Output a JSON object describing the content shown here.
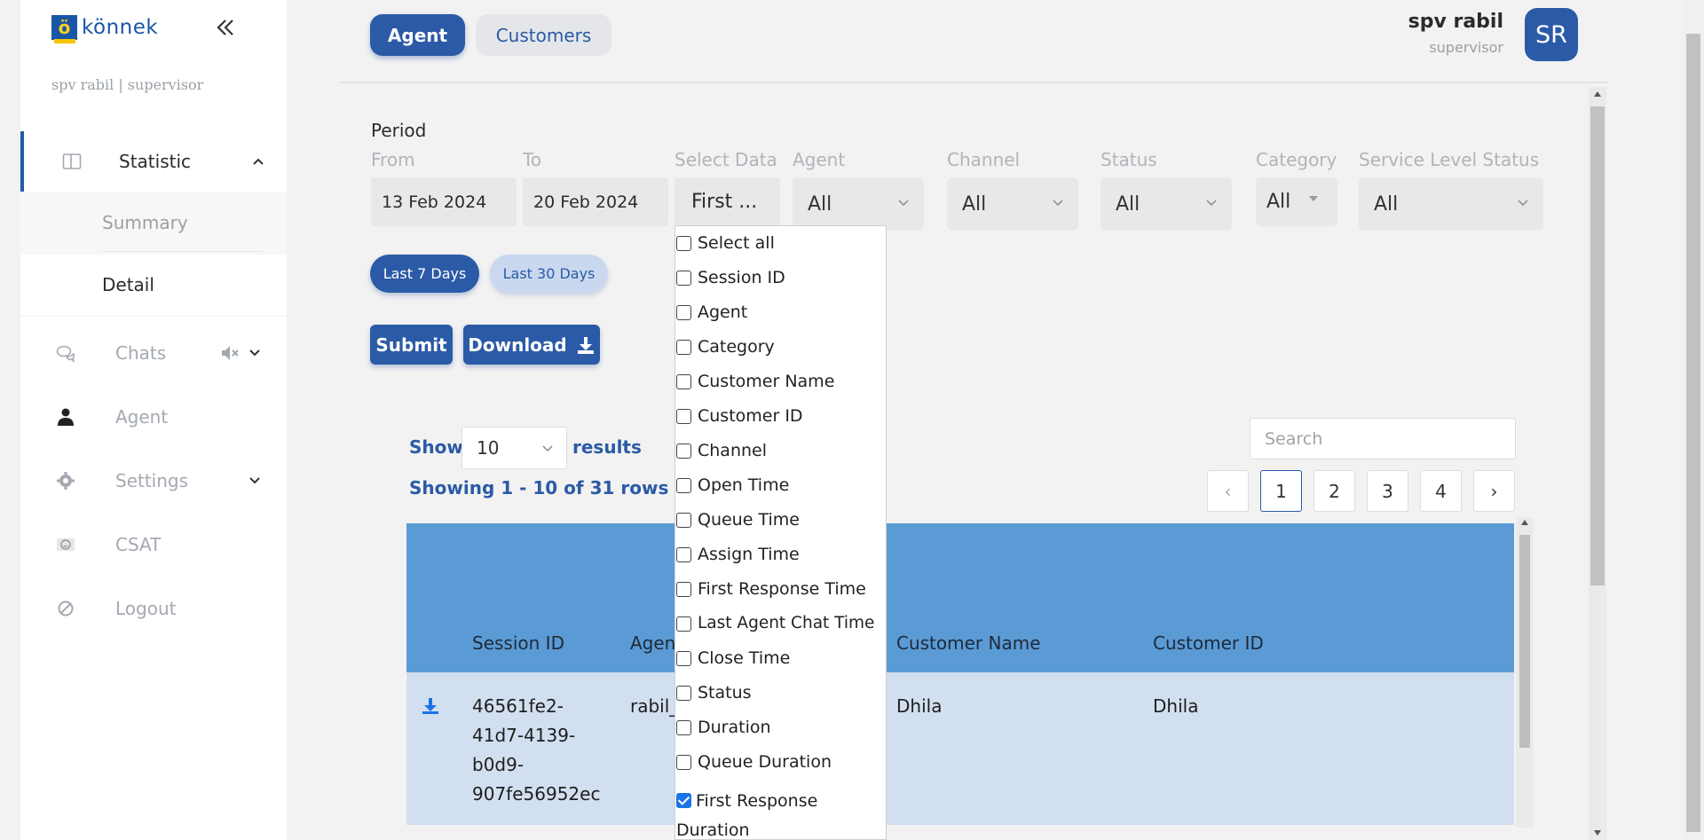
{
  "brand": {
    "name": "könnek",
    "mark": "ö"
  },
  "sidebar": {
    "user_line": "spv rabil | supervisor",
    "items": [
      {
        "label": "Statistic"
      },
      {
        "label": "Chats"
      },
      {
        "label": "Agent"
      },
      {
        "label": "Settings"
      },
      {
        "label": "CSAT"
      },
      {
        "label": "Logout"
      }
    ],
    "sub_items": [
      {
        "label": "Summary"
      },
      {
        "label": "Detail"
      }
    ]
  },
  "tabs": {
    "agent": "Agent",
    "customers": "Customers"
  },
  "profile": {
    "name": "spv rabil",
    "role": "supervisor",
    "initials": "SR"
  },
  "filters": {
    "period_label": "Period",
    "from_label": "From",
    "from_value": "13 Feb 2024",
    "to_label": "To",
    "to_value": "20 Feb 2024",
    "select_data_label": "Select Data",
    "select_data_value": "First ...",
    "agent_label": "Agent",
    "agent_value": "All",
    "channel_label": "Channel",
    "channel_value": "All",
    "status_label": "Status",
    "status_value": "All",
    "category_label": "Category",
    "category_value": "All",
    "sls_label": "Service Level Status",
    "sls_value": "All"
  },
  "quick_ranges": {
    "last7": "Last 7 Days",
    "last30": "Last 30 Days"
  },
  "actions": {
    "submit": "Submit",
    "download": "Download"
  },
  "table_controls": {
    "show_label": "Show",
    "page_size": "10",
    "results_label": "results",
    "rows_info": "Showing 1 - 10 of 31 rows",
    "search_placeholder": "Search",
    "pages": [
      "1",
      "2",
      "3",
      "4"
    ],
    "prev": "‹",
    "next": "›"
  },
  "table": {
    "headers": {
      "session_id": "Session ID",
      "agent": "Agent",
      "customer_name": "Customer Name",
      "customer_id": "Customer ID"
    },
    "rows": [
      {
        "session_id_lines": [
          "46561fe2-",
          "41d7-4139-",
          "b0d9-",
          "907fe56952ec"
        ],
        "agent": "rabil_",
        "customer_name": "Dhila",
        "customer_id": "Dhila"
      }
    ]
  },
  "select_data_options": [
    {
      "label": "Select all",
      "checked": false
    },
    {
      "label": "Session ID",
      "checked": false
    },
    {
      "label": "Agent",
      "checked": false
    },
    {
      "label": "Category",
      "checked": false
    },
    {
      "label": "Customer Name",
      "checked": false
    },
    {
      "label": "Customer ID",
      "checked": false
    },
    {
      "label": "Channel",
      "checked": false
    },
    {
      "label": "Open Time",
      "checked": false
    },
    {
      "label": "Queue Time",
      "checked": false
    },
    {
      "label": "Assign Time",
      "checked": false
    },
    {
      "label": "First Response Time",
      "checked": false
    },
    {
      "label": "Last Agent Chat Time",
      "checked": false
    },
    {
      "label": "Close Time",
      "checked": false
    },
    {
      "label": "Status",
      "checked": false
    },
    {
      "label": "Duration",
      "checked": false
    },
    {
      "label": "Queue Duration",
      "checked": false
    },
    {
      "label": "First Response Duration",
      "checked": true
    }
  ],
  "colors": {
    "primary": "#2b5aa6",
    "table_header": "#5b9bd5",
    "table_row": "#d2dff0",
    "sidebar_bg": "#ffffff",
    "page_bg": "#f2f2f2"
  }
}
